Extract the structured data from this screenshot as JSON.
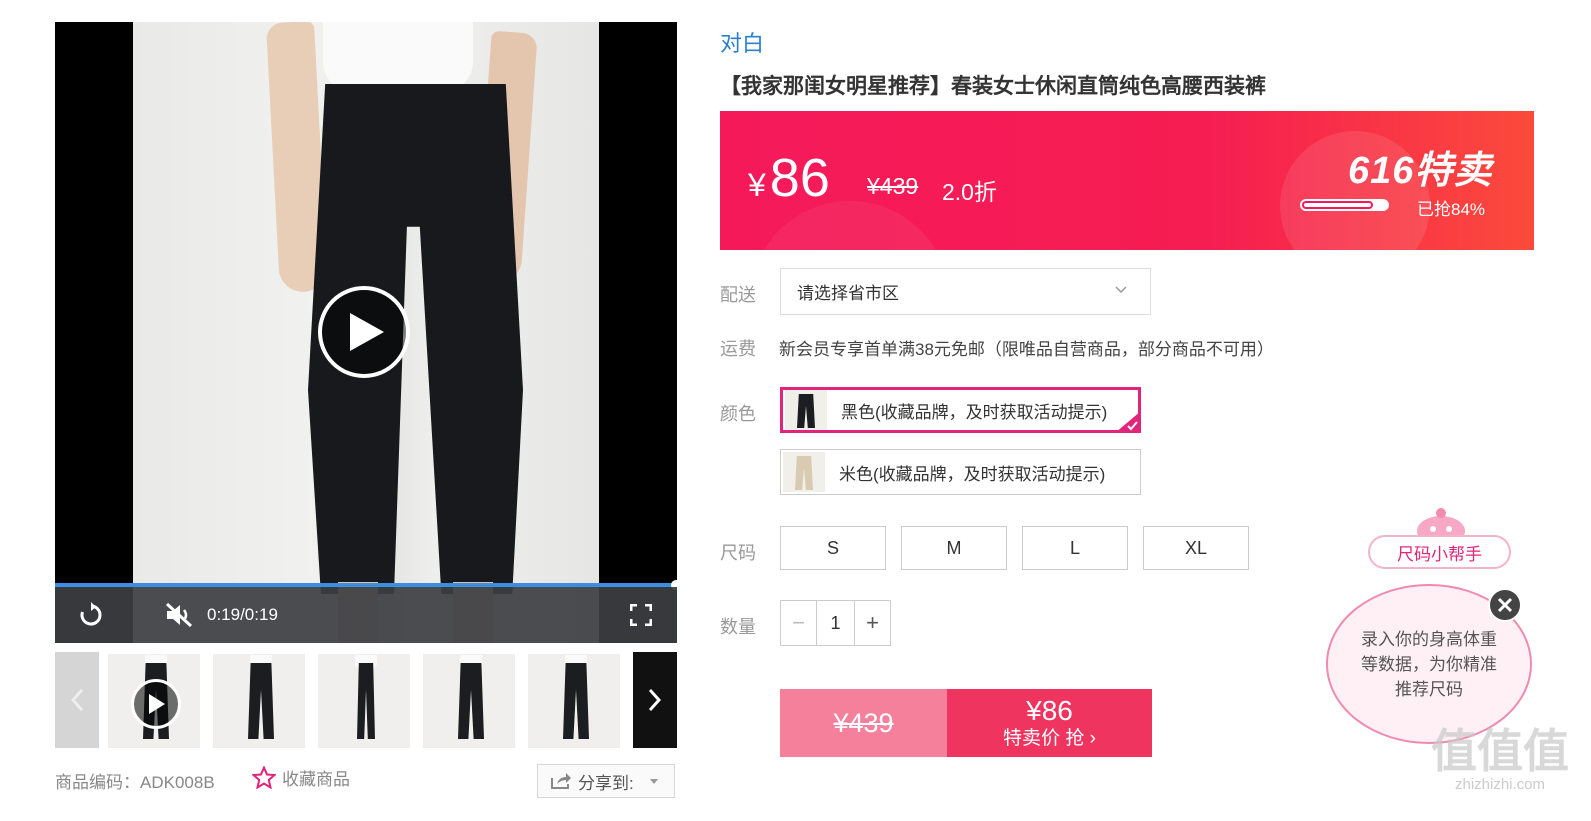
{
  "video": {
    "time": "0:19/0:19",
    "progress": 1.0
  },
  "meta": {
    "sku": "商品编码：ADK008B",
    "favorite_label": "收藏商品",
    "share_label": "分享到:"
  },
  "product": {
    "brand": "对白",
    "title": "【我家那闺女明星推荐】春装女士休闲直筒纯色高腰西装裤"
  },
  "price": {
    "currency": "¥",
    "current": "86",
    "original": "¥439",
    "discount": "2.0折",
    "promo_logo": "616特卖",
    "sold_text": "已抢84%",
    "sold_fraction": 0.84
  },
  "delivery": {
    "label": "配送",
    "placeholder": "请选择省市区"
  },
  "freight": {
    "label": "运费",
    "text": "新会员专享首单满38元免邮（限唯品自营商品，部分商品不可用）"
  },
  "colors": {
    "label": "颜色",
    "options": [
      {
        "label": "黑色(收藏品牌，及时获取活动提示)",
        "swatch": "#1b1d20",
        "selected": true
      },
      {
        "label": "米色(收藏品牌，及时获取活动提示)",
        "swatch": "#d9cbb2",
        "selected": false
      }
    ]
  },
  "sizes": {
    "label": "尺码",
    "options": [
      "S",
      "M",
      "L",
      "XL"
    ]
  },
  "quantity": {
    "label": "数量",
    "value": "1",
    "minus": "−",
    "plus": "+"
  },
  "buy": {
    "original": "¥439",
    "price": "¥86",
    "action": "特卖价 抢 ›"
  },
  "size_helper": {
    "tag": "尺码小帮手",
    "message": "录入你的身高体重等数据，为你精准推荐尺码"
  },
  "watermark": {
    "big": "值值值",
    "small": "zhizhizhi.com"
  },
  "colors_theme": {
    "accent_pink": "#e2257b",
    "price_red": "#f5195a",
    "brand_blue": "#2b7fd1"
  }
}
